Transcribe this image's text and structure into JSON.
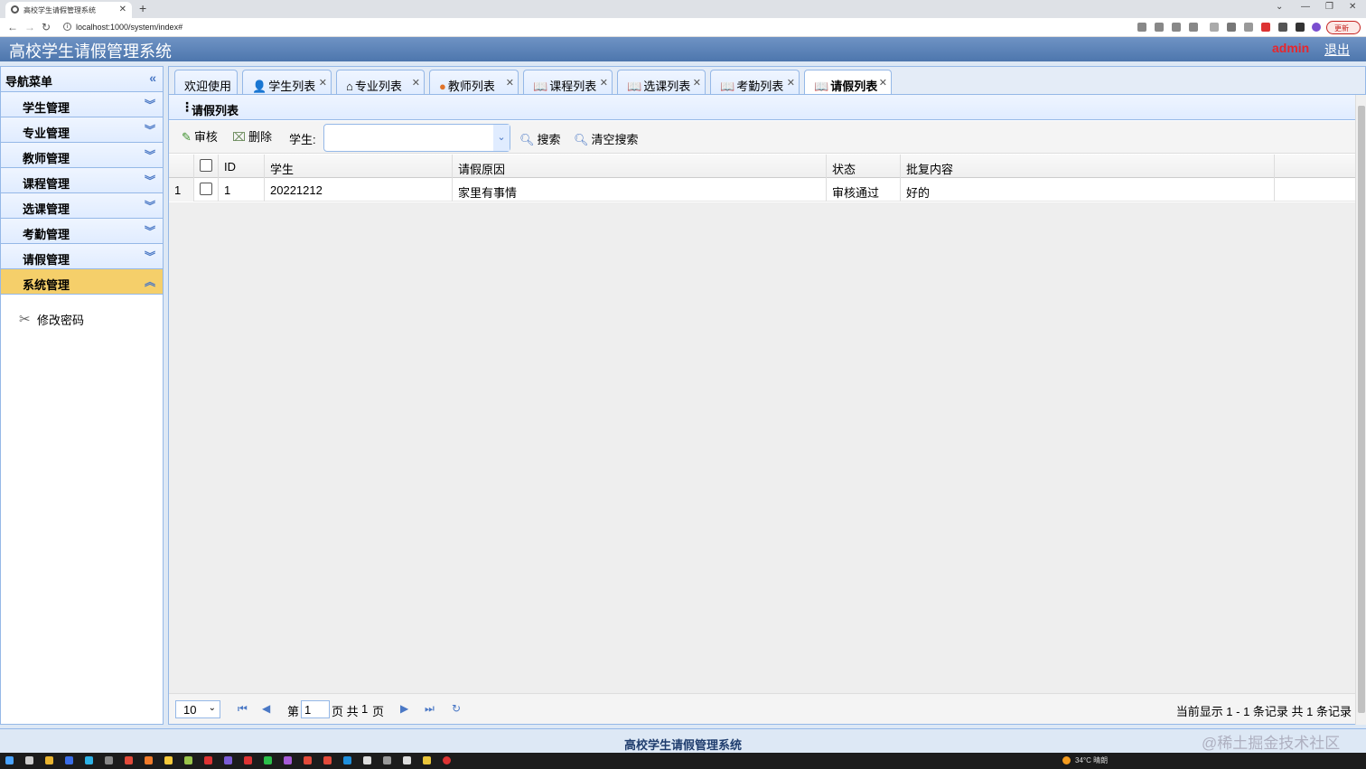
{
  "browser": {
    "tab_title": "高校学生请假管理系统",
    "url": "localhost:1000/system/index#",
    "update_label": "更新"
  },
  "header": {
    "title": "高校学生请假管理系统",
    "user": "admin",
    "logout": "退出"
  },
  "sidebar": {
    "title": "导航菜单",
    "items": [
      {
        "label": "学生管理"
      },
      {
        "label": "专业管理"
      },
      {
        "label": "教师管理"
      },
      {
        "label": "课程管理"
      },
      {
        "label": "选课管理"
      },
      {
        "label": "考勤管理"
      },
      {
        "label": "请假管理"
      },
      {
        "label": "系统管理"
      }
    ],
    "sub_item": "修改密码"
  },
  "tabs": [
    {
      "label": "欢迎使用"
    },
    {
      "label": "学生列表"
    },
    {
      "label": "专业列表"
    },
    {
      "label": "教师列表"
    },
    {
      "label": "课程列表"
    },
    {
      "label": "选课列表"
    },
    {
      "label": "考勤列表"
    },
    {
      "label": "请假列表"
    }
  ],
  "panel": {
    "title": "请假列表"
  },
  "toolbar": {
    "approve": "审核",
    "delete": "删除",
    "student_label": "学生:",
    "search": "搜索",
    "clear_search": "清空搜索"
  },
  "table": {
    "columns": [
      "ID",
      "学生",
      "请假原因",
      "状态",
      "批复内容"
    ],
    "rows": [
      {
        "index": "1",
        "id": "1",
        "student": "20221212",
        "reason": "家里有事情",
        "status": "审核通过",
        "reply": "好的"
      }
    ]
  },
  "pager": {
    "page_size": "10",
    "page_prefix": "第",
    "page": "1",
    "page_mid": "页 共",
    "total_pages": "1",
    "page_suffix": "页",
    "info": "当前显示 1 - 1 条记录 共 1 条记录"
  },
  "footer": "高校学生请假管理系统",
  "watermark": "@稀土掘金技术社区",
  "taskbar": {
    "weather": "34°C 晴朗"
  },
  "colors": {
    "header_bg": "#4d76ad",
    "admin": "#e8262b",
    "active_menu": "#f5cf6a",
    "border": "#95b8e7"
  }
}
